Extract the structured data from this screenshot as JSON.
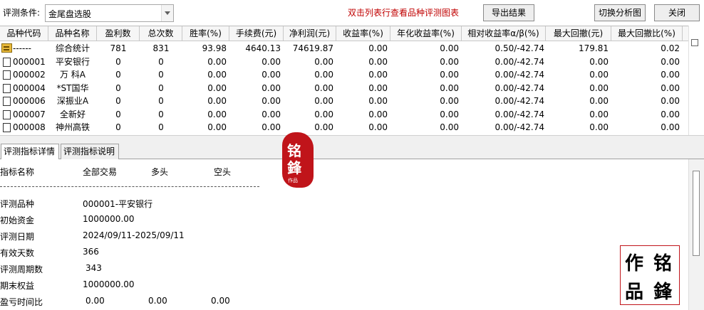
{
  "toolbar": {
    "condition_label": "评测条件:",
    "condition_value": "金尾盘选股",
    "hint": "双击列表行查看品种评测图表",
    "export_label": "导出结果",
    "switch_label": "切换分析图",
    "close_label": "关闭"
  },
  "grid": {
    "columns": [
      "品种代码",
      "品种名称",
      "盈利数",
      "总次数",
      "胜率(%)",
      "手续费(元)",
      "净利润(元)",
      "收益率(%)",
      "年化收益率(%)",
      "相对收益率α/β(%)",
      "最大回撤(元)",
      "最大回撤比(%)"
    ],
    "rows": [
      {
        "icon": "folder-icon",
        "code": "------",
        "name": "综合统计",
        "wins": "781",
        "total": "831",
        "win_rate": "93.98",
        "fee": "4640.13",
        "net_profit": "74619.87",
        "return": "0.00",
        "annual_return": "0.00",
        "alpha_beta": "0.50/-42.74",
        "max_dd": "179.81",
        "max_dd_ratio": "0.02"
      },
      {
        "icon": "document-icon",
        "code": "000001",
        "name": "平安银行",
        "wins": "0",
        "total": "0",
        "win_rate": "0.00",
        "fee": "0.00",
        "net_profit": "0.00",
        "return": "0.00",
        "annual_return": "0.00",
        "alpha_beta": "0.00/-42.74",
        "max_dd": "0.00",
        "max_dd_ratio": "0.00"
      },
      {
        "icon": "document-icon",
        "code": "000002",
        "name": "万 科A",
        "wins": "0",
        "total": "0",
        "win_rate": "0.00",
        "fee": "0.00",
        "net_profit": "0.00",
        "return": "0.00",
        "annual_return": "0.00",
        "alpha_beta": "0.00/-42.74",
        "max_dd": "0.00",
        "max_dd_ratio": "0.00"
      },
      {
        "icon": "document-icon",
        "code": "000004",
        "name": "*ST国华",
        "wins": "0",
        "total": "0",
        "win_rate": "0.00",
        "fee": "0.00",
        "net_profit": "0.00",
        "return": "0.00",
        "annual_return": "0.00",
        "alpha_beta": "0.00/-42.74",
        "max_dd": "0.00",
        "max_dd_ratio": "0.00"
      },
      {
        "icon": "document-icon",
        "code": "000006",
        "name": "深振业A",
        "wins": "0",
        "total": "0",
        "win_rate": "0.00",
        "fee": "0.00",
        "net_profit": "0.00",
        "return": "0.00",
        "annual_return": "0.00",
        "alpha_beta": "0.00/-42.74",
        "max_dd": "0.00",
        "max_dd_ratio": "0.00"
      },
      {
        "icon": "document-icon",
        "code": "000007",
        "name": "全新好",
        "wins": "0",
        "total": "0",
        "win_rate": "0.00",
        "fee": "0.00",
        "net_profit": "0.00",
        "return": "0.00",
        "annual_return": "0.00",
        "alpha_beta": "0.00/-42.74",
        "max_dd": "0.00",
        "max_dd_ratio": "0.00"
      },
      {
        "icon": "document-icon",
        "code": "000008",
        "name": "神州高铁",
        "wins": "0",
        "total": "0",
        "win_rate": "0.00",
        "fee": "0.00",
        "net_profit": "0.00",
        "return": "0.00",
        "annual_return": "0.00",
        "alpha_beta": "0.00/-42.74",
        "max_dd": "0.00",
        "max_dd_ratio": "0.00"
      }
    ]
  },
  "tabs": [
    "评测指标详情",
    "评测指标说明"
  ],
  "detail": {
    "header": [
      "指标名称",
      "全部交易",
      "多头",
      "空头"
    ],
    "items": [
      {
        "label": "评测品种",
        "value": "000001-平安银行"
      },
      {
        "label": "初始资金",
        "value": "1000000.00"
      },
      {
        "label": "评测日期",
        "value": "2024/09/11-2025/09/11"
      },
      {
        "label": "有效天数",
        "value": "366"
      },
      {
        "label": "评测周期数",
        "value": "343"
      },
      {
        "label": "期末权益",
        "value": "1000000.00"
      }
    ],
    "profit_time_ratio": {
      "label": "盈亏时间比",
      "all": "0.00",
      "long": "0.00",
      "short": "0.00"
    }
  },
  "seal_small": [
    "铭",
    "鋒",
    "作品"
  ],
  "seal_box": [
    "铭",
    "鋒",
    "作",
    "品"
  ],
  "colors": {
    "hint": "#c00000",
    "seal": "#c0141a",
    "header_bg": "#f6f6f6"
  }
}
